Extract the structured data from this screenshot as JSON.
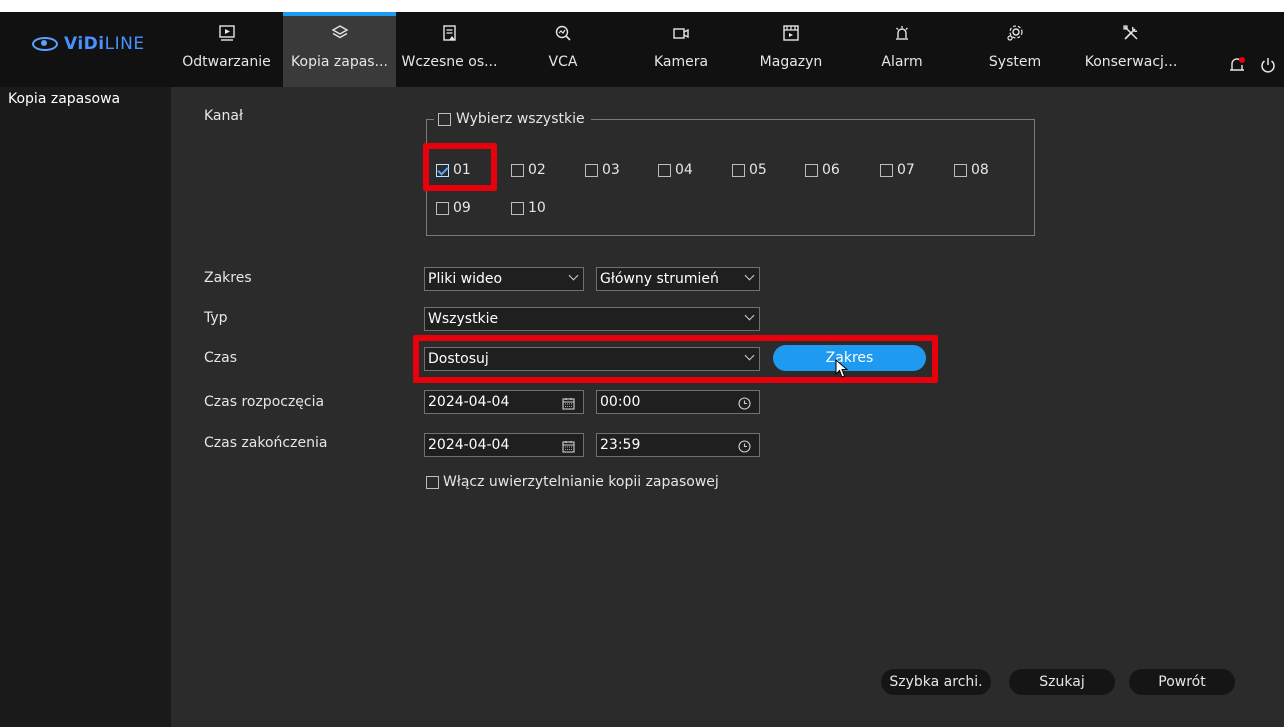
{
  "logo": {
    "brand_bold": "ViDi",
    "brand_rest": "LINE"
  },
  "nav": [
    {
      "label": "Odtwarzanie",
      "icon": "playback-icon"
    },
    {
      "label": "Kopia zapas...",
      "icon": "layers-icon",
      "active": true
    },
    {
      "label": "Wczesne os...",
      "icon": "document-alert-icon"
    },
    {
      "label": "VCA",
      "icon": "vca-icon"
    },
    {
      "label": "Kamera",
      "icon": "camera-icon"
    },
    {
      "label": "Magazyn",
      "icon": "storage-icon"
    },
    {
      "label": "Alarm",
      "icon": "alarm-icon"
    },
    {
      "label": "System",
      "icon": "gear-icon"
    },
    {
      "label": "Konserwacj...",
      "icon": "tools-icon"
    }
  ],
  "topbar_right": {
    "notification_icon": "bell-icon",
    "power_icon": "power-icon"
  },
  "sidebar": {
    "items": [
      {
        "label": "Kopia zapasowa",
        "selected": true
      }
    ]
  },
  "form": {
    "kanal_label": "Kanał",
    "select_all_label": "Wybierz wszystkie",
    "channels": [
      {
        "label": "01",
        "checked": true
      },
      {
        "label": "02",
        "checked": false
      },
      {
        "label": "03",
        "checked": false
      },
      {
        "label": "04",
        "checked": false
      },
      {
        "label": "05",
        "checked": false
      },
      {
        "label": "06",
        "checked": false
      },
      {
        "label": "07",
        "checked": false
      },
      {
        "label": "08",
        "checked": false
      },
      {
        "label": "09",
        "checked": false
      },
      {
        "label": "10",
        "checked": false
      }
    ],
    "zakres_label": "Zakres",
    "zakres_value": "Pliki wideo",
    "stream_value": "Główny strumień",
    "typ_label": "Typ",
    "typ_value": "Wszystkie",
    "czas_label": "Czas",
    "czas_value": "Dostosuj",
    "range_button": "Zakres",
    "start_label": "Czas rozpoczęcia",
    "start_date": "2024-04-04",
    "start_time": "00:00",
    "end_label": "Czas zakończenia",
    "end_date": "2024-04-04",
    "end_time": "23:59",
    "auth_label": "Włącz uwierzytelnianie kopii zapasowej"
  },
  "footer": {
    "quick_archive": "Szybka archi.",
    "search": "Szukaj",
    "back": "Powrót"
  },
  "colors": {
    "accent": "#1e9bf0",
    "highlight": "#e8000d",
    "background": "#2b2b2b"
  }
}
